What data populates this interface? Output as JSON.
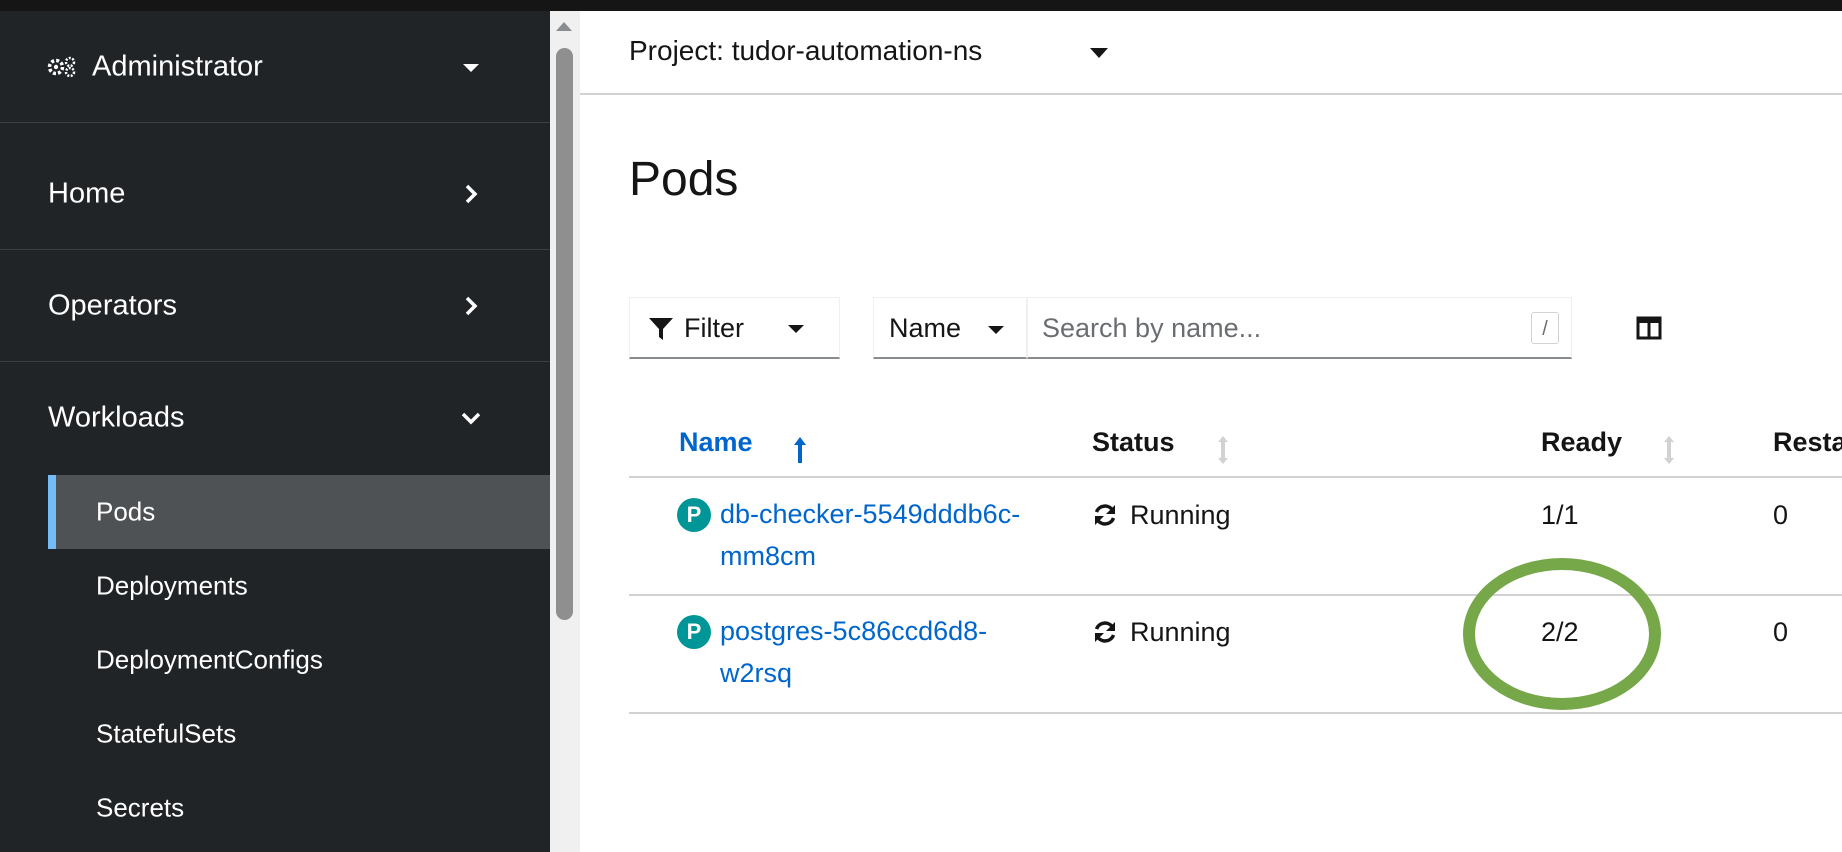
{
  "sidebar": {
    "perspective": {
      "label": "Administrator",
      "icon": "gears-icon",
      "chevron": "caret-down-icon"
    },
    "sections": [
      {
        "label": "Home",
        "chevron": "chevron-right-icon"
      },
      {
        "label": "Operators",
        "chevron": "chevron-right-icon"
      },
      {
        "label": "Workloads",
        "chevron": "chevron-down-icon"
      }
    ],
    "workloads_items": [
      {
        "label": "Pods",
        "active": true
      },
      {
        "label": "Deployments",
        "active": false
      },
      {
        "label": "DeploymentConfigs",
        "active": false
      },
      {
        "label": "StatefulSets",
        "active": false
      },
      {
        "label": "Secrets",
        "active": false
      }
    ]
  },
  "project": {
    "label": "Project: tudor-automation-ns"
  },
  "page": {
    "title": "Pods"
  },
  "toolbar": {
    "filter_label": "Filter",
    "name_select_label": "Name",
    "search_placeholder": "Search by name...",
    "search_shortcut": "/"
  },
  "table": {
    "columns": [
      {
        "label": "Name",
        "sorted": "asc"
      },
      {
        "label": "Status",
        "sorted": "none"
      },
      {
        "label": "Ready",
        "sorted": "none"
      },
      {
        "label": "Resta",
        "sorted": "none"
      }
    ],
    "rows": [
      {
        "badge": "P",
        "name": "db-checker-5549dddb6c-mm8cm",
        "status": "Running",
        "ready": "1/1",
        "restarts": "0"
      },
      {
        "badge": "P",
        "name": "postgres-5c86ccd6d8-w2rsq",
        "status": "Running",
        "ready": "2/2",
        "restarts": "0"
      }
    ]
  },
  "colors": {
    "sidebar_bg": "#212427",
    "active_item_bg": "#4f5255",
    "active_indicator": "#73bcf7",
    "link": "#0066cc",
    "pod_badge": "#009596",
    "highlight_annotation": "#76a84a"
  }
}
